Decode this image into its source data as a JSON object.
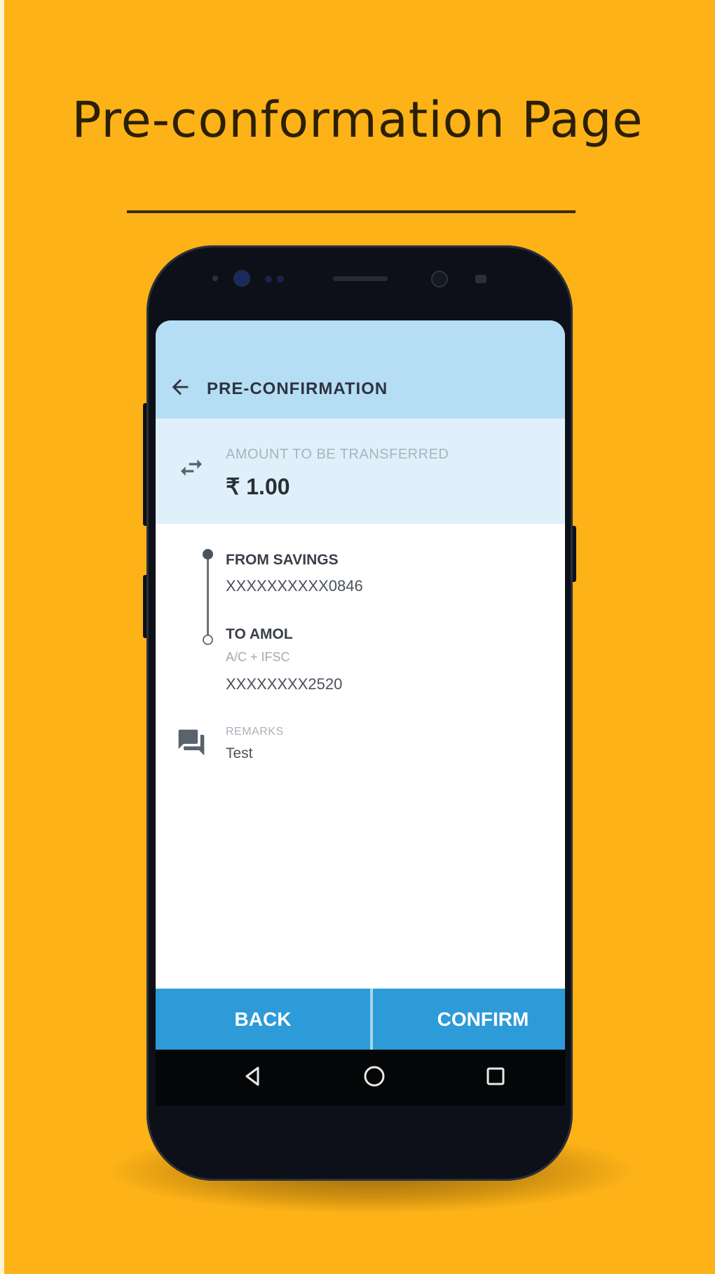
{
  "promo": {
    "title": "Pre-conformation Page"
  },
  "app_bar": {
    "back_icon": "arrow-left-icon",
    "title": "PRE-CONFIRMATION"
  },
  "amount": {
    "icon": "transfer-arrows-icon",
    "label": "AMOUNT TO BE TRANSFERRED",
    "value": "₹ 1.00"
  },
  "from": {
    "label": "FROM SAVINGS",
    "account": "XXXXXXXXXX0846"
  },
  "to": {
    "label": "TO AMOL",
    "sub": "A/C + IFSC",
    "account": "XXXXXXXX2520"
  },
  "remarks": {
    "icon": "chat-bubbles-icon",
    "label": "REMARKS",
    "value": "Test"
  },
  "actions": {
    "back_label": "BACK",
    "confirm_label": "CONFIRM"
  },
  "system_nav": {
    "back_icon": "triangle-back-icon",
    "home_icon": "circle-home-icon",
    "recent_icon": "square-recents-icon"
  },
  "colors": {
    "background": "#FDB217",
    "app_bar": "#B5DDF4",
    "amount_section": "#DFF0FB",
    "action_bar": "#2D9BD8",
    "phone_body": "#0D1018"
  }
}
